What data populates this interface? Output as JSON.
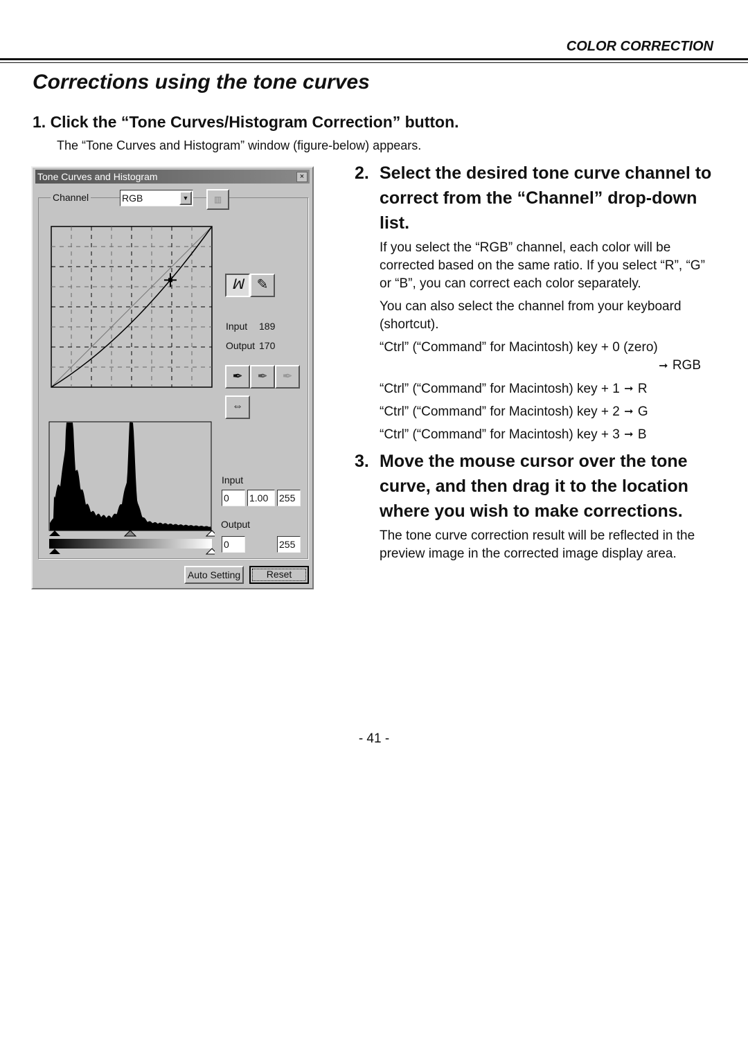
{
  "header": {
    "section": "COLOR CORRECTION"
  },
  "title": "Corrections using the tone curves",
  "step1": {
    "heading": "1.  Click the “Tone Curves/Histogram Correction” button.",
    "text": "The “Tone Curves and Histogram” window (figure-below) appears."
  },
  "step2": {
    "num": "2.",
    "heading": "Select the desired tone curve channel to correct from the “Channel” drop-down list.",
    "p1": "If you select the “RGB” channel, each color will be corrected based on the same ratio. If you select “R”, “G” or “B”, you can correct each color separately.",
    "p2": "You can also select the channel from your keyboard (shortcut).",
    "shortcuts": [
      {
        "keys": "“Ctrl” (“Command” for Macintosh) key + 0 (zero)",
        "target": "RGB"
      },
      {
        "keys": "“Ctrl” (“Command” for Macintosh) key + 1",
        "target": "R"
      },
      {
        "keys": "“Ctrl” (“Command” for Macintosh) key + 2",
        "target": "G"
      },
      {
        "keys": "“Ctrl” (“Command” for Macintosh) key + 3",
        "target": "B"
      }
    ]
  },
  "step3": {
    "num": "3.",
    "heading": "Move the mouse cursor over the tone curve, and then drag it to the location where you wish to make corrections.",
    "p1": "The tone curve correction result will be reflected in the preview image in the corrected image display area."
  },
  "window": {
    "title": "Tone Curves and Histogram",
    "close": "×",
    "channel_label": "Channel",
    "channel_value": "RGB",
    "input_label": "Input",
    "input_value": "189",
    "output_label": "Output",
    "output_value": "170",
    "levels": {
      "input_label": "Input",
      "input_black": "0",
      "input_gamma": "1.00",
      "input_white": "255",
      "output_label": "Output",
      "output_black": "0",
      "output_white": "255"
    },
    "auto_setting": "Auto Setting",
    "reset": "Reset"
  },
  "page_number": "- 41 -"
}
